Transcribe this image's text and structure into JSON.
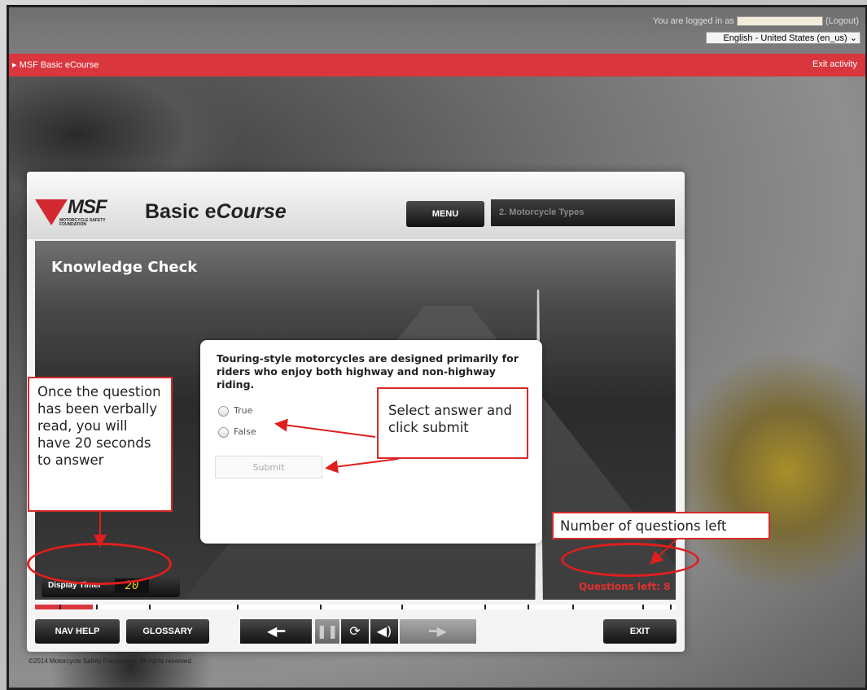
{
  "topbar": {
    "login_prefix": "You are logged in as",
    "logout_label": "(Logout)",
    "language": "English - United States (en_us)"
  },
  "nav": {
    "breadcrumb": "MSF Basic eCourse",
    "exit_activity": "Exit activity"
  },
  "course": {
    "logo_text": "MSF",
    "logo_sub": "MOTORCYCLE SAFETY FOUNDATION",
    "title_plain": "Basic e",
    "title_italic": "Course",
    "menu_label": "MENU",
    "chapter": "2. Motorcycle Types",
    "section": "Knowledge Check",
    "question": "Touring-style motorcycles are designed primarily for riders who enjoy both highway and non-highway riding.",
    "options": [
      "True",
      "False"
    ],
    "submit_label": "Submit",
    "timer_label": "Display Timer",
    "timer_value": "20",
    "questions_left": "Questions left: 8",
    "nav_help": "NAV HELP",
    "glossary": "GLOSSARY",
    "exit": "EXIT",
    "copyright": "©2014 Motorcycle Safety Foundation. All rights reserved.",
    "progress_fraction": 0.09
  },
  "annotations": {
    "timer_note": "Once the question has been verbally read, you will have 20 seconds to answer",
    "select_note": "Select answer and click submit",
    "questions_note": "Number of questions left"
  },
  "colors": {
    "accent_red": "#d9363e",
    "annotation_red": "#e01e1e",
    "timer_yellow": "#e8d22a"
  }
}
